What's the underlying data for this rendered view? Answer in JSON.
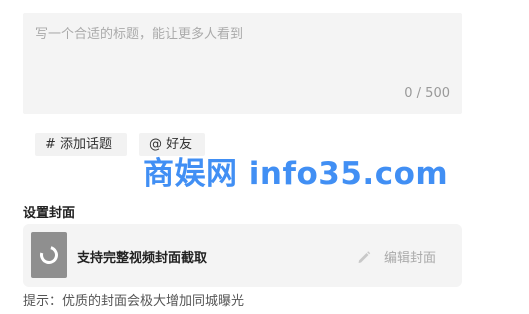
{
  "title_input": {
    "placeholder": "写一个合适的标题，能让更多人看到",
    "value": "",
    "counter": "0 / 500"
  },
  "tags": {
    "topic_label": "# 添加话题",
    "friend_label": "@ 好友"
  },
  "watermark": "商娱网 info35.com",
  "cover": {
    "heading": "设置封面",
    "label": "支持完整视频封面截取",
    "edit_label": "编辑封面",
    "thumb_icon": "loading-spinner-icon",
    "edit_icon": "pencil-icon"
  },
  "hint": "提示：优质的封面会极大增加同城曝光",
  "colors": {
    "input_bg": "#f4f4f4",
    "muted_text": "#aaaaaa",
    "watermark": "#1877f2"
  }
}
